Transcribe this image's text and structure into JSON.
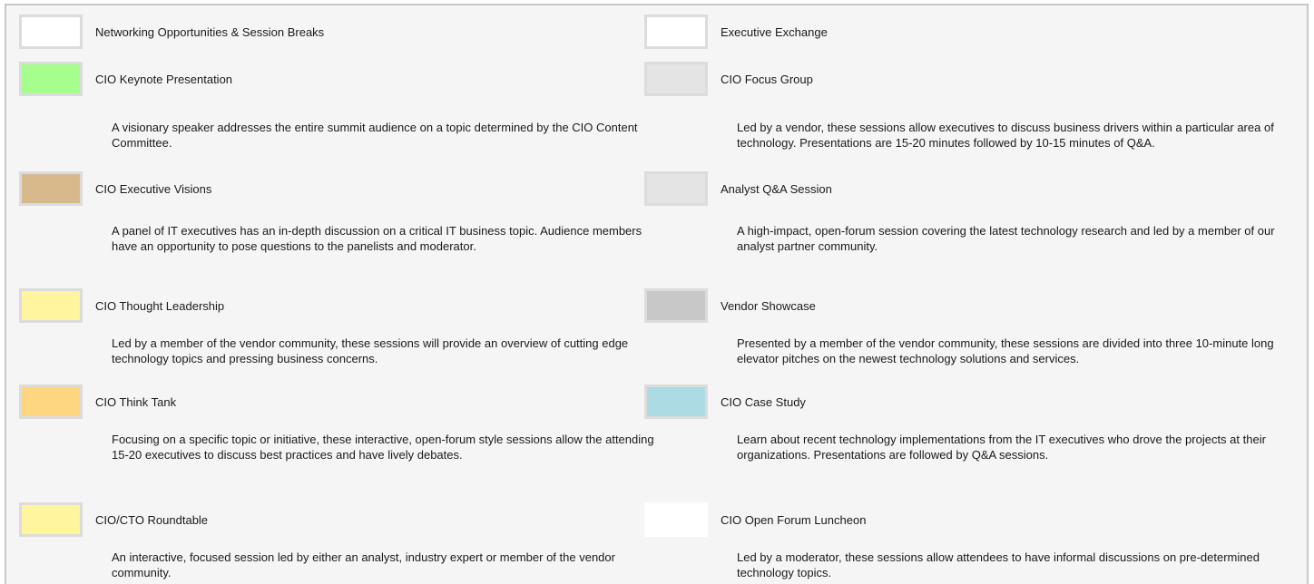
{
  "legend": {
    "left": [
      {
        "label": "Networking Opportunities & Session Breaks",
        "color": "#ffffff",
        "description": ""
      },
      {
        "label": "CIO Keynote Presentation",
        "color": "#a6ff8c",
        "description": "A visionary speaker addresses the entire summit audience on a topic determined by the CIO Content Committee."
      },
      {
        "label": "CIO Executive Visions",
        "color": "#d7b98b",
        "description": "A panel of IT executives has an in-depth discussion on a critical IT business topic. Audience members have an opportunity to pose questions to the panelists and moderator."
      },
      {
        "label": "CIO Thought Leadership",
        "color": "#fff59e",
        "description": "Led by a member of the vendor community, these sessions will provide an overview of cutting edge technology topics and pressing business concerns."
      },
      {
        "label": "CIO Think Tank",
        "color": "#ffd680",
        "description": "Focusing on a specific topic or initiative, these interactive, open-forum style sessions allow the attending 15-20 executives to discuss best practices and have lively debates."
      },
      {
        "label": "CIO/CTO Roundtable",
        "color": "#fff59e",
        "description": "An interactive, focused session led by either an analyst, industry expert or member of the vendor community."
      }
    ],
    "right": [
      {
        "label": "Executive Exchange",
        "color": "#ffffff",
        "description": ""
      },
      {
        "label": "CIO Focus Group",
        "color": "#e4e4e4",
        "description": "Led by a vendor, these sessions allow executives to discuss business drivers within a particular area of technology. Presentations are 15-20 minutes followed by 10-15 minutes of Q&A."
      },
      {
        "label": "Analyst Q&A Session",
        "color": "#e4e4e4",
        "description": "A high-impact, open-forum session covering the latest technology research and led by a member of our analyst partner community."
      },
      {
        "label": "Vendor Showcase",
        "color": "#c8c8c8",
        "description": "Presented by a member of the vendor community, these sessions are divided into three 10-minute long elevator pitches on the newest technology solutions and services."
      },
      {
        "label": "CIO Case Study",
        "color": "#acdbe3",
        "description": "Learn about recent technology implementations from the IT executives who drove the projects at their organizations. Presentations are followed by Q&A sessions."
      },
      {
        "label": "CIO Open Forum Luncheon",
        "color": "#ffffff",
        "description": "Led by a moderator, these sessions allow attendees to have informal discussions on pre-determined technology topics."
      }
    ]
  }
}
